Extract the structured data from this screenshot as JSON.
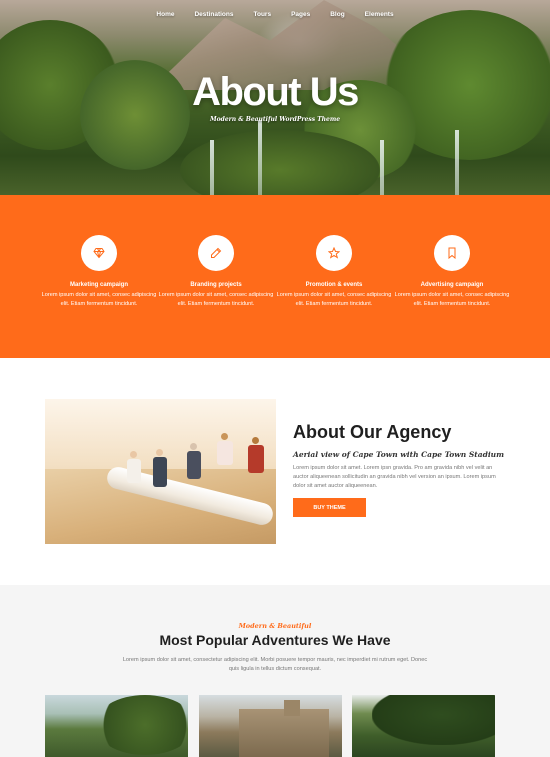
{
  "nav": {
    "items": [
      "Home",
      "Destinations",
      "Tours",
      "Pages",
      "Blog",
      "Elements"
    ]
  },
  "hero": {
    "title": "About Us",
    "subtitle": "Modern & Beautiful WordPress Theme"
  },
  "features": [
    {
      "icon": "diamond-icon",
      "title": "Marketing campaign",
      "text": "Lorem ipsum dolor sit amet, consec adipiscing elit. Etiam fermentum tincidunt."
    },
    {
      "icon": "pencil-icon",
      "title": "Branding projects",
      "text": "Lorem ipsum dolor sit amet, consec adipiscing elit. Etiam fermentum tincidunt."
    },
    {
      "icon": "star-icon",
      "title": "Promotion & events",
      "text": "Lorem ipsum dolor sit amet, consec adipiscing elit. Etiam fermentum tincidunt."
    },
    {
      "icon": "bookmark-icon",
      "title": "Advertising campaign",
      "text": "Lorem ipsum dolor sit amet, consec adipiscing elit. Etiam fermentum tincidunt."
    }
  ],
  "agency": {
    "title": "About Our Agency",
    "subtitle": "Aerial view of Cape Town with Cape Town Stadium",
    "text": "Lorem ipsum dolor sit amet. Lorem ipsn gravida. Pro am gravida nibh vel velit an auctor aliqueenean sollicitudin an gravida nibh vel version an ipsum. Lorem ipsum dolor sit amet auctor aliqueenean.",
    "button": "BUY THEME"
  },
  "adventures": {
    "kicker": "Modern & Beautiful",
    "title": "Most Popular Adventures We Have",
    "text": "Lorem ipsum dolor sit amet, consectetur adipiscing elit. Morbi posuere tempor mauris, nec imperdiet mi rutrum eget. Donec quis ligula in tellus dictum consequat."
  },
  "colors": {
    "accent": "#ff6b1a",
    "heading": "#1f1f1f",
    "body_text": "#777777",
    "section_bg": "#f5f5f5"
  }
}
